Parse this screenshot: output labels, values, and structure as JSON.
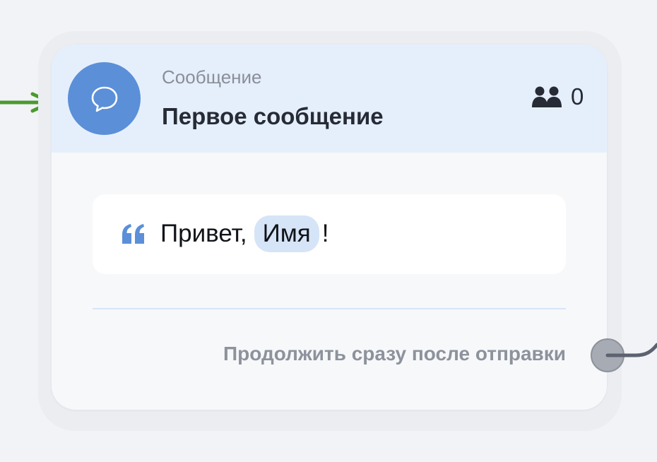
{
  "node": {
    "type_label": "Сообщение",
    "title": "Первое сообщение",
    "type_icon": "chat-bubble-icon",
    "subscribers_icon": "users-icon",
    "subscribers_count": "0"
  },
  "message": {
    "quote_icon": "quote-icon",
    "text_before": "Привет,",
    "variable": "Имя",
    "text_after": "!"
  },
  "continue": {
    "label": "Продолжить сразу после отправки"
  },
  "colors": {
    "accent": "#5b8fd8",
    "header_bg": "#e5effc",
    "variable_bg": "#d6e4f7",
    "incoming_arrow": "#4a9a2f",
    "connector": "#5c6270"
  }
}
